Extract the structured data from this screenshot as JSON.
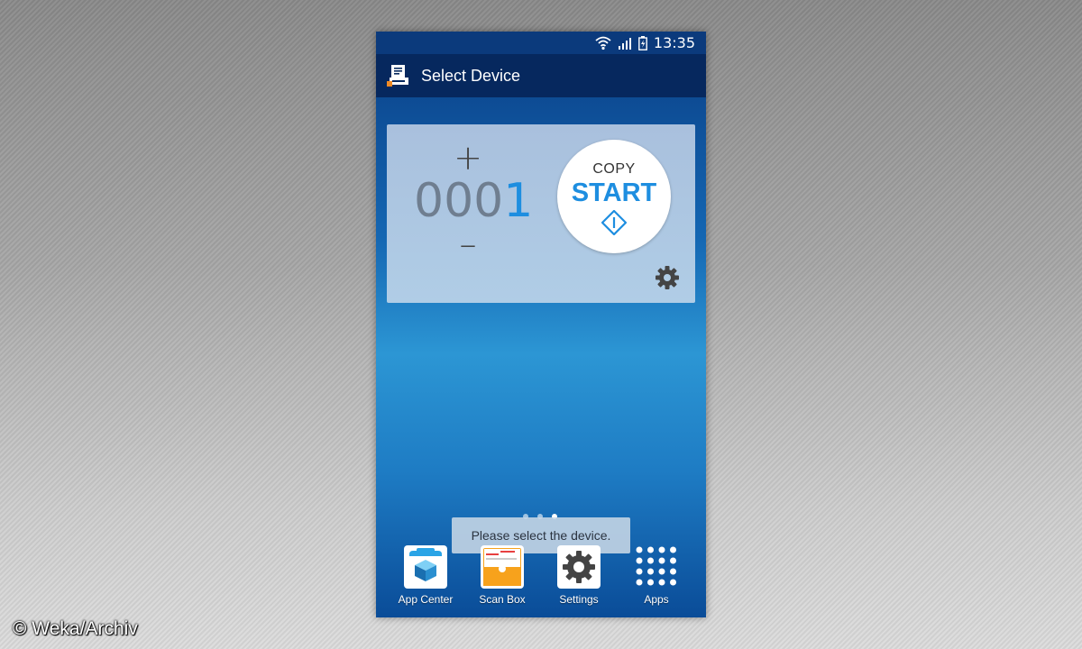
{
  "statusbar": {
    "time": "13:35",
    "icons": [
      "wifi-icon",
      "signal-icon",
      "battery-icon"
    ]
  },
  "appbar": {
    "title": "Select Device",
    "icon": "printer-icon"
  },
  "copy_widget": {
    "count_prefix": "000",
    "count_last": "1",
    "plus_label": "+",
    "minus_label": "–",
    "start_top": "COPY",
    "start_label": "START",
    "accent": "#1e8ee0"
  },
  "page_indicator": {
    "pages": 3,
    "active": 2
  },
  "toast": {
    "text": "Please select the device."
  },
  "dock": [
    {
      "label": "App Center",
      "icon": "app-center-icon"
    },
    {
      "label": "Scan Box",
      "icon": "scan-box-icon"
    },
    {
      "label": "Settings",
      "icon": "settings-icon"
    },
    {
      "label": "Apps",
      "icon": "apps-grid-icon"
    }
  ],
  "watermark": "© Weka/Archiv"
}
